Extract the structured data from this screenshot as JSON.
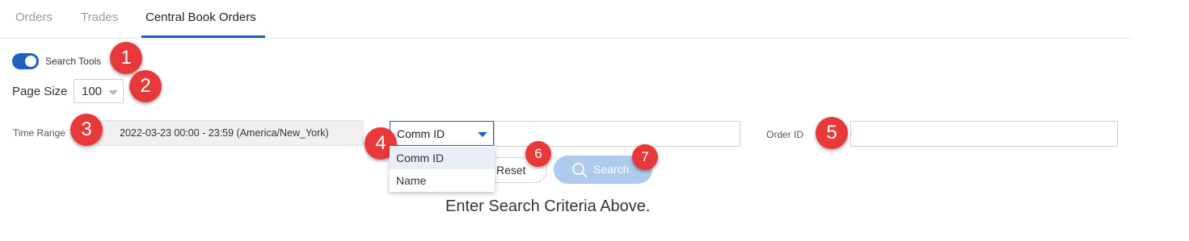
{
  "tabs": [
    {
      "label": "Orders",
      "active": false
    },
    {
      "label": "Trades",
      "active": false
    },
    {
      "label": "Central Book Orders",
      "active": true
    }
  ],
  "search_tools": {
    "label": "Search Tools",
    "enabled": true
  },
  "page_size": {
    "label": "Page Size",
    "value": "100"
  },
  "time_range": {
    "label": "Time Range",
    "value": "2022-03-23 00:00 - 23:59 (America/New_York)"
  },
  "search_field": {
    "selected": "Comm ID",
    "options": [
      "Comm ID",
      "Name"
    ],
    "value": ""
  },
  "order_id": {
    "label": "Order ID",
    "value": ""
  },
  "buttons": {
    "reset": "Reset",
    "search": "Search"
  },
  "empty_message": "Enter Search Criteria Above.",
  "callouts": [
    "1",
    "2",
    "3",
    "4",
    "5",
    "6",
    "7"
  ],
  "colors": {
    "accent": "#1f5fbf",
    "badge": "#e8393a",
    "search_button": "#aecaed"
  }
}
